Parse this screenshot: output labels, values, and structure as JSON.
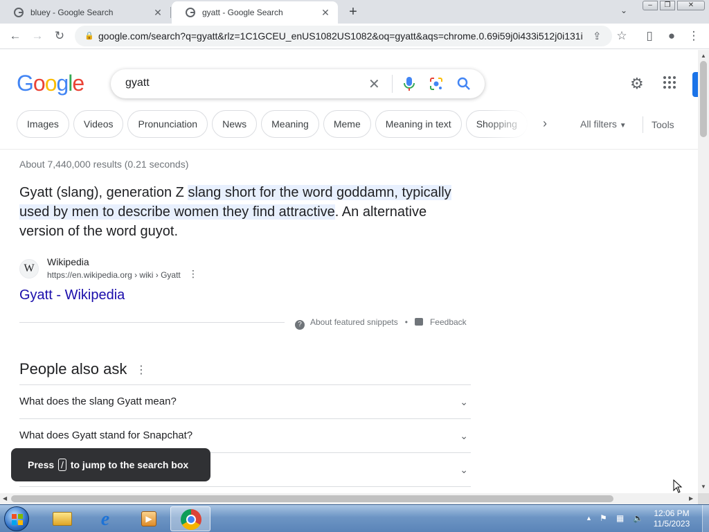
{
  "browser": {
    "tabs": [
      {
        "title": "bluey - Google Search",
        "active": false
      },
      {
        "title": "gyatt - Google Search",
        "active": true
      }
    ],
    "url": "google.com/search?q=gyatt&rlz=1C1GCEU_enUS1082US1082&oq=gyatt&aqs=chrome.0.69i59j0i433i512j0i131i..."
  },
  "search": {
    "logo": "Google",
    "query": "gyatt"
  },
  "chips": [
    "Images",
    "Videos",
    "Pronunciation",
    "News",
    "Meaning",
    "Meme",
    "Meaning in text",
    "Shopping"
  ],
  "filters": {
    "all_filters": "All filters",
    "tools": "Tools"
  },
  "results": {
    "stats": "About 7,440,000 results (0.21 seconds)",
    "snippet": {
      "before": "Gyatt (slang), generation Z ",
      "highlight": "slang short for the word goddamn, typically used by men to describe women they find attractive",
      "after": ". An alternative version of the word guyot."
    },
    "source": {
      "favicon": "W",
      "site": "Wikipedia",
      "cite": "https://en.wikipedia.org › wiki › Gyatt",
      "link_title": "Gyatt - Wikipedia"
    },
    "about_snippets": "About featured snippets",
    "feedback": "Feedback"
  },
  "people_also_ask": {
    "title": "People also ask",
    "questions": [
      "What does the slang Gyatt mean?",
      "What does Gyatt stand for Snapchat?",
      ""
    ]
  },
  "toast": {
    "prefix": "Press",
    "key": "/",
    "suffix": "to jump to the search box"
  },
  "taskbar": {
    "time": "12:06 PM",
    "date": "11/5/2023"
  },
  "colors": {
    "link": "#1a0dab",
    "accent": "#1a73e8",
    "highlight": "#e8f0fe",
    "toast_bg": "#303134"
  },
  "icons": [
    "google-favicon-icon",
    "close-icon",
    "plus-icon",
    "back-icon",
    "forward-icon",
    "reload-icon",
    "lock-icon",
    "share-icon",
    "star-icon",
    "sidepanel-icon",
    "profile-icon",
    "menu-icon",
    "clear-icon",
    "mic-icon",
    "lens-icon",
    "search-icon",
    "gear-icon",
    "apps-grid-icon",
    "chevron-right-icon",
    "chevron-down-icon",
    "help-icon",
    "feedback-icon"
  ]
}
